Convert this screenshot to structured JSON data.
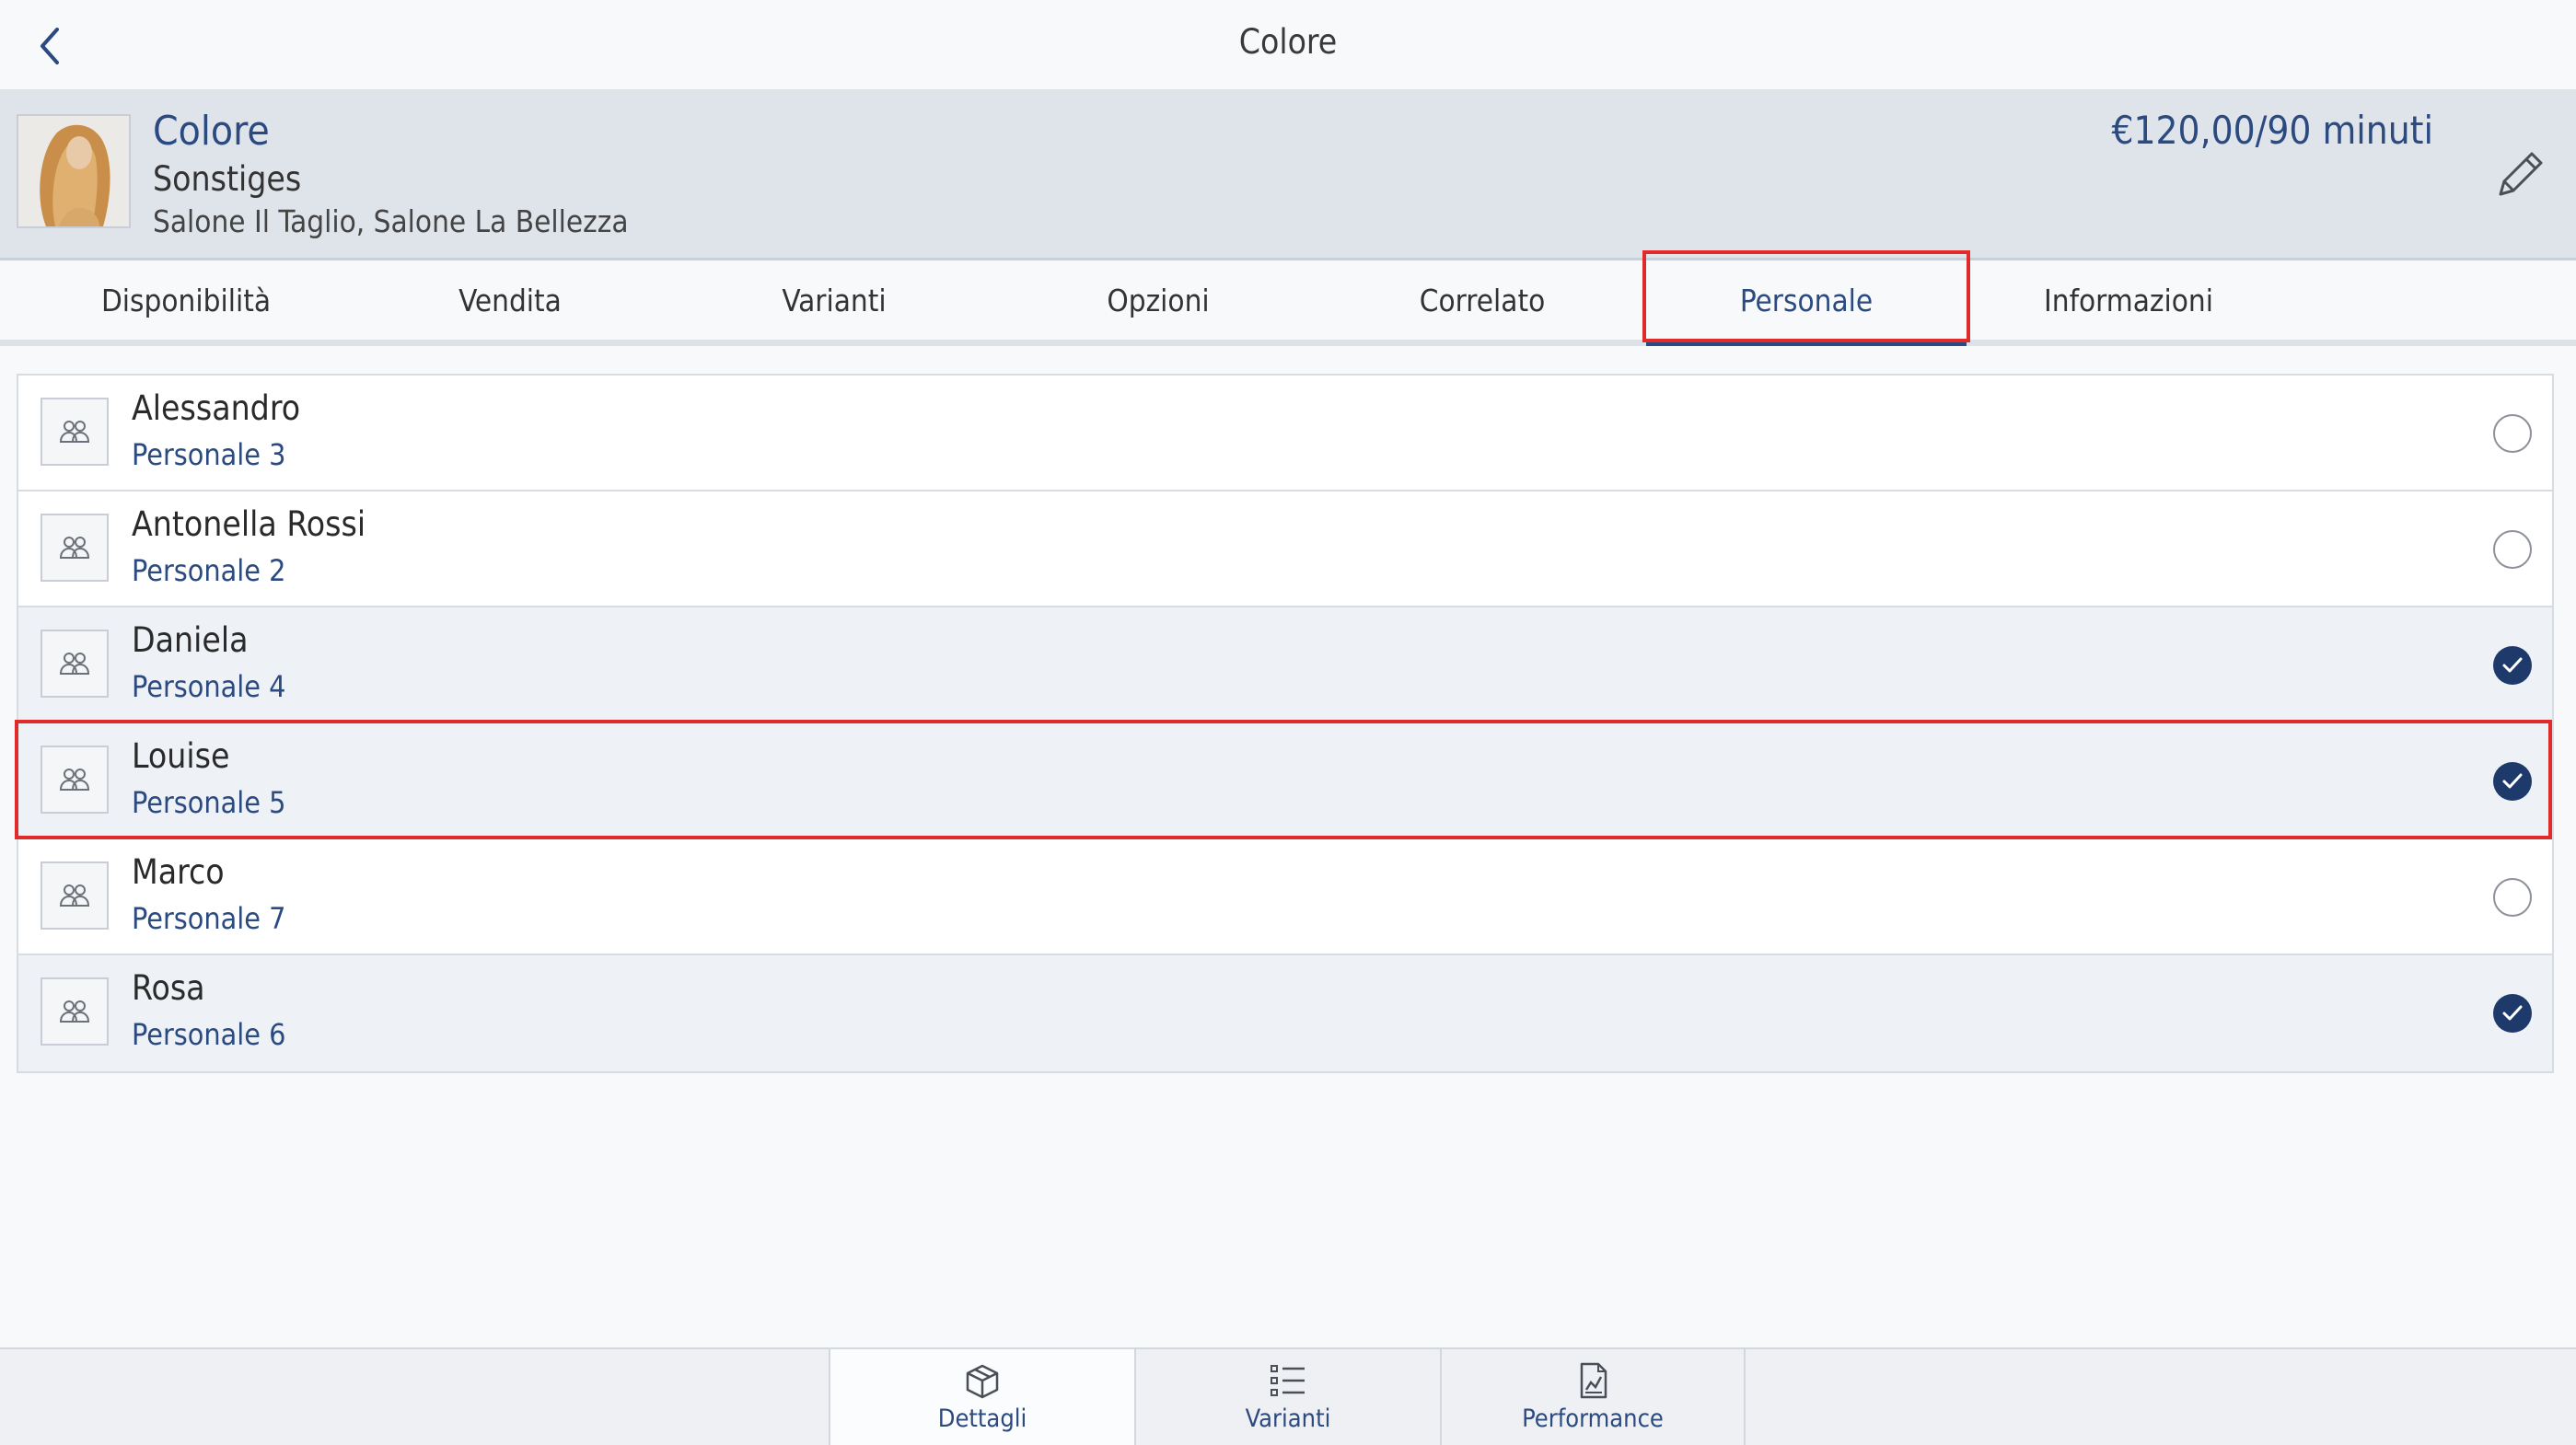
{
  "topbar": {
    "title": "Colore"
  },
  "service": {
    "name": "Colore",
    "category": "Sonstiges",
    "locations": "Salone Il Taglio, Salone La Bellezza",
    "price": "€120,00/90 minuti"
  },
  "tabs": [
    {
      "label": "Disponibilità",
      "active": false
    },
    {
      "label": "Vendita",
      "active": false
    },
    {
      "label": "Varianti",
      "active": false
    },
    {
      "label": "Opzioni",
      "active": false
    },
    {
      "label": "Correlato",
      "active": false
    },
    {
      "label": "Personale",
      "active": true
    },
    {
      "label": "Informazioni",
      "active": false
    }
  ],
  "staff": [
    {
      "name": "Alessandro",
      "role": "Personale 3",
      "selected": false
    },
    {
      "name": "Antonella Rossi",
      "role": "Personale 2",
      "selected": false
    },
    {
      "name": "Daniela",
      "role": "Personale 4",
      "selected": true
    },
    {
      "name": "Louise",
      "role": "Personale 5",
      "selected": true
    },
    {
      "name": "Marco",
      "role": "Personale 7",
      "selected": false
    },
    {
      "name": "Rosa",
      "role": "Personale 6",
      "selected": true
    }
  ],
  "bottom_tabs": [
    {
      "label": "Dettagli",
      "icon": "box-icon",
      "active": true
    },
    {
      "label": "Varianti",
      "icon": "list-icon",
      "active": false
    },
    {
      "label": "Performance",
      "icon": "chart-document-icon",
      "active": false
    }
  ],
  "colors": {
    "accent": "#2b4a80",
    "checked": "#1e3a6b",
    "highlight": "#e12b2b",
    "header_bg": "#dfe4eb"
  }
}
